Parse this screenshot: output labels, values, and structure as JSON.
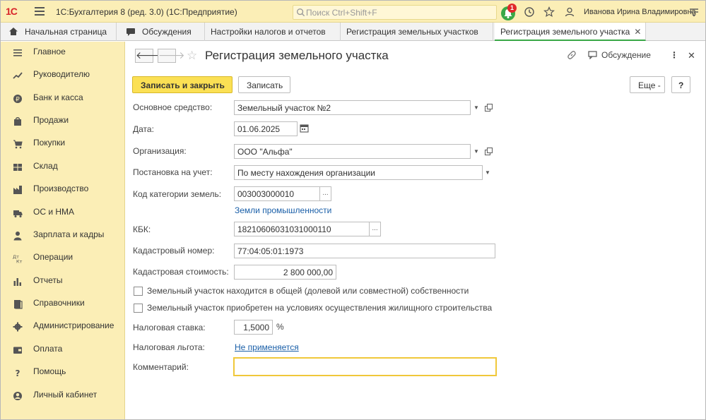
{
  "titlebar": {
    "logo": "1С",
    "app_title": "1С:Бухгалтерия 8 (ред. 3.0)  (1С:Предприятие)",
    "search_placeholder": "Поиск Ctrl+Shift+F",
    "notifications_count": "1",
    "user_name": "Иванова Ирина Владимировна"
  },
  "tabs": [
    {
      "label": "Начальная страница",
      "icon": "home-icon"
    },
    {
      "label": "Обсуждения",
      "icon": "chat-icon"
    },
    {
      "label": "Настройки налогов и отчетов"
    },
    {
      "label": "Регистрация земельных участков"
    },
    {
      "label": "Регистрация земельного участка",
      "active": true
    }
  ],
  "sidebar": {
    "items": [
      {
        "label": "Главное",
        "icon": "menu-lines-icon"
      },
      {
        "label": "Руководителю",
        "icon": "trend-icon"
      },
      {
        "label": "Банк и касса",
        "icon": "ruble-coin-icon"
      },
      {
        "label": "Продажи",
        "icon": "bag-icon"
      },
      {
        "label": "Покупки",
        "icon": "cart-icon"
      },
      {
        "label": "Склад",
        "icon": "warehouse-icon"
      },
      {
        "label": "Производство",
        "icon": "factory-icon"
      },
      {
        "label": "ОС и НМА",
        "icon": "truck-icon"
      },
      {
        "label": "Зарплата и кадры",
        "icon": "person-icon"
      },
      {
        "label": "Операции",
        "icon": "dt-kt-icon"
      },
      {
        "label": "Отчеты",
        "icon": "bar-chart-icon"
      },
      {
        "label": "Справочники",
        "icon": "books-icon"
      },
      {
        "label": "Администрирование",
        "icon": "gear-icon"
      },
      {
        "label": "Оплата",
        "icon": "wallet-icon"
      },
      {
        "label": "Помощь",
        "icon": "question-icon"
      },
      {
        "label": "Личный кабинет",
        "icon": "account-icon"
      }
    ]
  },
  "form": {
    "title": "Регистрация земельного участка",
    "discussion_label": "Обсуждение",
    "save_close_label": "Записать и закрыть",
    "save_label": "Записать",
    "more_label": "Еще -",
    "help_label": "?",
    "fields": {
      "asset": {
        "label": "Основное средство:",
        "value": "Земельный участок №2"
      },
      "date": {
        "label": "Дата:",
        "value": "01.06.2025"
      },
      "org": {
        "label": "Организация:",
        "value": "ООО \"Альфа\""
      },
      "registration": {
        "label": "Постановка на учет:",
        "value": "По месту нахождения организации"
      },
      "category_code": {
        "label": "Код категории земель:",
        "value": "003003000010",
        "hint": "Земли промышленности"
      },
      "kbk": {
        "label": "КБК:",
        "value": "18210606031031000110"
      },
      "cadastral_number": {
        "label": "Кадастровый номер:",
        "value": "77:04:05:01:1973"
      },
      "cadastral_value": {
        "label": "Кадастровая стоимость:",
        "value": "2 800 000,00"
      },
      "shared_ownership": {
        "label": "Земельный участок находится в общей (долевой или совместной) собственности",
        "checked": false
      },
      "housing_construction": {
        "label": "Земельный участок приобретен на условиях осуществления жилищного строительства",
        "checked": false
      },
      "tax_rate": {
        "label": "Налоговая ставка:",
        "value": "1,5000",
        "unit": "%"
      },
      "tax_benefit": {
        "label": "Налоговая льгота:",
        "value": "Не применяется"
      },
      "comment": {
        "label": "Комментарий:",
        "value": ""
      }
    }
  },
  "colors": {
    "panel_yellow": "#fbeeb6",
    "primary_button": "#fbe054",
    "active_tab_accent": "#3aa847",
    "link_blue": "#1a5fa8",
    "focus_border": "#f0c83a",
    "logo_red": "#d8232a"
  }
}
